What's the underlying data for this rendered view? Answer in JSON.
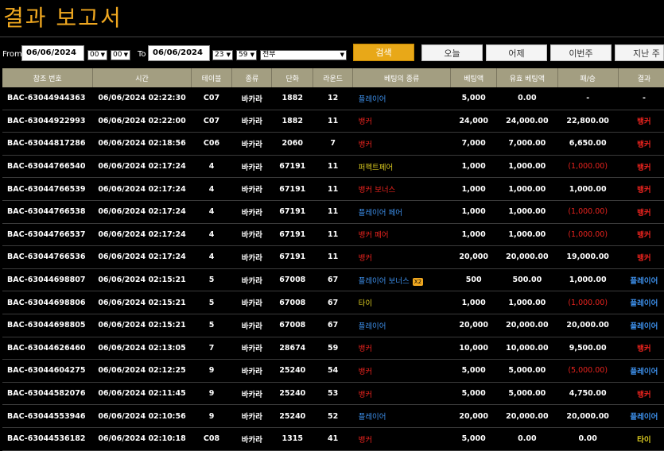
{
  "page": {
    "title": "결과 보고서"
  },
  "filters": {
    "from_label": "From",
    "from_date": "06/06/2024",
    "from_hour": "00",
    "from_min": "00",
    "to_label": "To",
    "to_date": "06/06/2024",
    "to_hour": "23",
    "to_min": "59",
    "type_select": "전부",
    "search_label": "검색",
    "today_label": "오늘",
    "yesterday_label": "어제",
    "this_week_label": "이번주",
    "last_week_label": "지난 주"
  },
  "colors": {
    "accent": "#f0a820",
    "header_bg": "#a39e81",
    "banker": "#e8231e",
    "player": "#3c8ee8",
    "tie": "#d8c820"
  },
  "table": {
    "headers": [
      "참조 번호",
      "시간",
      "테이블",
      "종류",
      "단화",
      "라운드",
      "베팅의 종류",
      "베팅액",
      "유효 베팅액",
      "패/승",
      "결과"
    ],
    "rows": [
      {
        "ref": "BAC-63044944363",
        "time": "06/06/2024 02:22:30",
        "table": "C07",
        "type": "바카라",
        "shoe": "1882",
        "round": "12",
        "bet": "플레이어",
        "bet_color": "blue",
        "amount": "5,000",
        "valid": "0.00",
        "winloss": "-",
        "wl_neg": false,
        "result": "-",
        "result_color": "white",
        "badge": ""
      },
      {
        "ref": "BAC-63044922993",
        "time": "06/06/2024 02:22:00",
        "table": "C07",
        "type": "바카라",
        "shoe": "1882",
        "round": "11",
        "bet": "뱅커",
        "bet_color": "red",
        "amount": "24,000",
        "valid": "24,000.00",
        "winloss": "22,800.00",
        "wl_neg": false,
        "result": "뱅커",
        "result_color": "red",
        "badge": ""
      },
      {
        "ref": "BAC-63044817286",
        "time": "06/06/2024 02:18:56",
        "table": "C06",
        "type": "바카라",
        "shoe": "2060",
        "round": "7",
        "bet": "뱅커",
        "bet_color": "red",
        "amount": "7,000",
        "valid": "7,000.00",
        "winloss": "6,650.00",
        "wl_neg": false,
        "result": "뱅커",
        "result_color": "red",
        "badge": ""
      },
      {
        "ref": "BAC-63044766540",
        "time": "06/06/2024 02:17:24",
        "table": "4",
        "type": "바카라",
        "shoe": "67191",
        "round": "11",
        "bet": "퍼펙트페어",
        "bet_color": "yellow",
        "amount": "1,000",
        "valid": "1,000.00",
        "winloss": "(1,000.00)",
        "wl_neg": true,
        "result": "뱅커",
        "result_color": "red",
        "badge": ""
      },
      {
        "ref": "BAC-63044766539",
        "time": "06/06/2024 02:17:24",
        "table": "4",
        "type": "바카라",
        "shoe": "67191",
        "round": "11",
        "bet": "뱅커 보너스",
        "bet_color": "red",
        "amount": "1,000",
        "valid": "1,000.00",
        "winloss": "1,000.00",
        "wl_neg": false,
        "result": "뱅커",
        "result_color": "red",
        "badge": ""
      },
      {
        "ref": "BAC-63044766538",
        "time": "06/06/2024 02:17:24",
        "table": "4",
        "type": "바카라",
        "shoe": "67191",
        "round": "11",
        "bet": "플레이어 페어",
        "bet_color": "blue",
        "amount": "1,000",
        "valid": "1,000.00",
        "winloss": "(1,000.00)",
        "wl_neg": true,
        "result": "뱅커",
        "result_color": "red",
        "badge": ""
      },
      {
        "ref": "BAC-63044766537",
        "time": "06/06/2024 02:17:24",
        "table": "4",
        "type": "바카라",
        "shoe": "67191",
        "round": "11",
        "bet": "뱅커 페어",
        "bet_color": "red",
        "amount": "1,000",
        "valid": "1,000.00",
        "winloss": "(1,000.00)",
        "wl_neg": true,
        "result": "뱅커",
        "result_color": "red",
        "badge": ""
      },
      {
        "ref": "BAC-63044766536",
        "time": "06/06/2024 02:17:24",
        "table": "4",
        "type": "바카라",
        "shoe": "67191",
        "round": "11",
        "bet": "뱅커",
        "bet_color": "red",
        "amount": "20,000",
        "valid": "20,000.00",
        "winloss": "19,000.00",
        "wl_neg": false,
        "result": "뱅커",
        "result_color": "red",
        "badge": ""
      },
      {
        "ref": "BAC-63044698807",
        "time": "06/06/2024 02:15:21",
        "table": "5",
        "type": "바카라",
        "shoe": "67008",
        "round": "67",
        "bet": "플레이어 보너스",
        "bet_color": "blue",
        "amount": "500",
        "valid": "500.00",
        "winloss": "1,000.00",
        "wl_neg": false,
        "result": "플레이어",
        "result_color": "blue",
        "badge": "X2"
      },
      {
        "ref": "BAC-63044698806",
        "time": "06/06/2024 02:15:21",
        "table": "5",
        "type": "바카라",
        "shoe": "67008",
        "round": "67",
        "bet": "타이",
        "bet_color": "yellow",
        "amount": "1,000",
        "valid": "1,000.00",
        "winloss": "(1,000.00)",
        "wl_neg": true,
        "result": "플레이어",
        "result_color": "blue",
        "badge": ""
      },
      {
        "ref": "BAC-63044698805",
        "time": "06/06/2024 02:15:21",
        "table": "5",
        "type": "바카라",
        "shoe": "67008",
        "round": "67",
        "bet": "플레이어",
        "bet_color": "blue",
        "amount": "20,000",
        "valid": "20,000.00",
        "winloss": "20,000.00",
        "wl_neg": false,
        "result": "플레이어",
        "result_color": "blue",
        "badge": ""
      },
      {
        "ref": "BAC-63044626460",
        "time": "06/06/2024 02:13:05",
        "table": "7",
        "type": "바카라",
        "shoe": "28674",
        "round": "59",
        "bet": "뱅커",
        "bet_color": "red",
        "amount": "10,000",
        "valid": "10,000.00",
        "winloss": "9,500.00",
        "wl_neg": false,
        "result": "뱅커",
        "result_color": "red",
        "badge": ""
      },
      {
        "ref": "BAC-63044604275",
        "time": "06/06/2024 02:12:25",
        "table": "9",
        "type": "바카라",
        "shoe": "25240",
        "round": "54",
        "bet": "뱅커",
        "bet_color": "red",
        "amount": "5,000",
        "valid": "5,000.00",
        "winloss": "(5,000.00)",
        "wl_neg": true,
        "result": "플레이어",
        "result_color": "blue",
        "badge": ""
      },
      {
        "ref": "BAC-63044582076",
        "time": "06/06/2024 02:11:45",
        "table": "9",
        "type": "바카라",
        "shoe": "25240",
        "round": "53",
        "bet": "뱅커",
        "bet_color": "red",
        "amount": "5,000",
        "valid": "5,000.00",
        "winloss": "4,750.00",
        "wl_neg": false,
        "result": "뱅커",
        "result_color": "red",
        "badge": ""
      },
      {
        "ref": "BAC-63044553946",
        "time": "06/06/2024 02:10:56",
        "table": "9",
        "type": "바카라",
        "shoe": "25240",
        "round": "52",
        "bet": "플레이어",
        "bet_color": "blue",
        "amount": "20,000",
        "valid": "20,000.00",
        "winloss": "20,000.00",
        "wl_neg": false,
        "result": "플레이어",
        "result_color": "blue",
        "badge": ""
      },
      {
        "ref": "BAC-63044536182",
        "time": "06/06/2024 02:10:18",
        "table": "C08",
        "type": "바카라",
        "shoe": "1315",
        "round": "41",
        "bet": "뱅커",
        "bet_color": "red",
        "amount": "5,000",
        "valid": "0.00",
        "winloss": "0.00",
        "wl_neg": false,
        "result": "타이",
        "result_color": "yellow",
        "badge": ""
      }
    ]
  }
}
